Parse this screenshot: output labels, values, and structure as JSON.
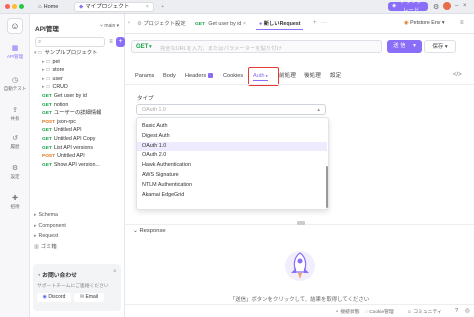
{
  "titlebar": {
    "home_label": "Home",
    "project_tab": "マイプロジェクト",
    "upgrade_label": "アップグレード"
  },
  "rail": {
    "items": [
      {
        "label": "API管理",
        "icon": "api-icon"
      },
      {
        "label": "自動テスト",
        "icon": "test-icon"
      },
      {
        "label": "共有",
        "icon": "share-icon"
      },
      {
        "label": "履歴",
        "icon": "history-icon"
      },
      {
        "label": "設定",
        "icon": "settings-icon"
      },
      {
        "label": "招待",
        "icon": "invite-icon"
      }
    ]
  },
  "sidebar": {
    "title": "API管理",
    "branch": "main",
    "search_placeholder": "",
    "tree": [
      {
        "indent": 0,
        "icon": "folder",
        "label": "サンプルプロジェクト"
      },
      {
        "indent": 1,
        "icon": "folder",
        "label": "pet"
      },
      {
        "indent": 1,
        "icon": "folder",
        "label": "store"
      },
      {
        "indent": 1,
        "icon": "folder",
        "label": "user"
      },
      {
        "indent": 1,
        "icon": "folder",
        "label": "CRUD"
      },
      {
        "indent": 1,
        "method": "GET",
        "label": "Get user by id"
      },
      {
        "indent": 1,
        "method": "GET",
        "label": "notion"
      },
      {
        "indent": 1,
        "method": "GET",
        "label": "ユーザーの詳細情報"
      },
      {
        "indent": 1,
        "method": "POST",
        "label": "json-rpc"
      },
      {
        "indent": 1,
        "method": "GET",
        "label": "Untitled API"
      },
      {
        "indent": 1,
        "method": "GET",
        "label": "Untitled API Copy"
      },
      {
        "indent": 1,
        "method": "GET",
        "label": "List API versions"
      },
      {
        "indent": 1,
        "method": "POST",
        "label": "Untitled API"
      },
      {
        "indent": 1,
        "method": "GET",
        "label": "Show API version..."
      }
    ],
    "sections": [
      "Schema",
      "Component",
      "Request",
      "ゴミ箱"
    ],
    "contact": {
      "title": "お問い合わせ",
      "text": "サポートチームにご連絡ください",
      "discord": "Discord",
      "email": "Email"
    }
  },
  "request_tabs": [
    {
      "method": "",
      "label": "プロジェクト設定"
    },
    {
      "method": "GET",
      "label": "Get user by id"
    },
    {
      "method": "",
      "label": "新しいRequest"
    }
  ],
  "env_label": "Petstore Env",
  "request": {
    "method": "GET",
    "url_placeholder": "完全なURLを入力、またはパラメーターを貼り付け",
    "send_label": "送 信",
    "save_label": "保存"
  },
  "subtabs": [
    "Params",
    "Body",
    "Headers",
    "Cookies",
    "Auth",
    "前処理",
    "後処理",
    "設定"
  ],
  "auth": {
    "type_label": "タイプ",
    "selected_value": "OAuth 1.0",
    "options": [
      "Basic Auth",
      "Digest Auth",
      "OAuth 1.0",
      "OAuth 2.0",
      "Hawk Authentication",
      "AWS Signature",
      "NTLM Authentication",
      "Akamai EdgeGrid"
    ]
  },
  "response": {
    "title": "Response",
    "hint": "「送信」ボタンをクリックして、結果を取得してください"
  },
  "statusbar": {
    "items": [
      "接続状態",
      "Cookie管理",
      "コミュニティ"
    ]
  },
  "colors": {
    "accent": "#8b6ef7",
    "highlight_border": "#e53935",
    "get": "#17a34a",
    "post": "#e0761b"
  }
}
